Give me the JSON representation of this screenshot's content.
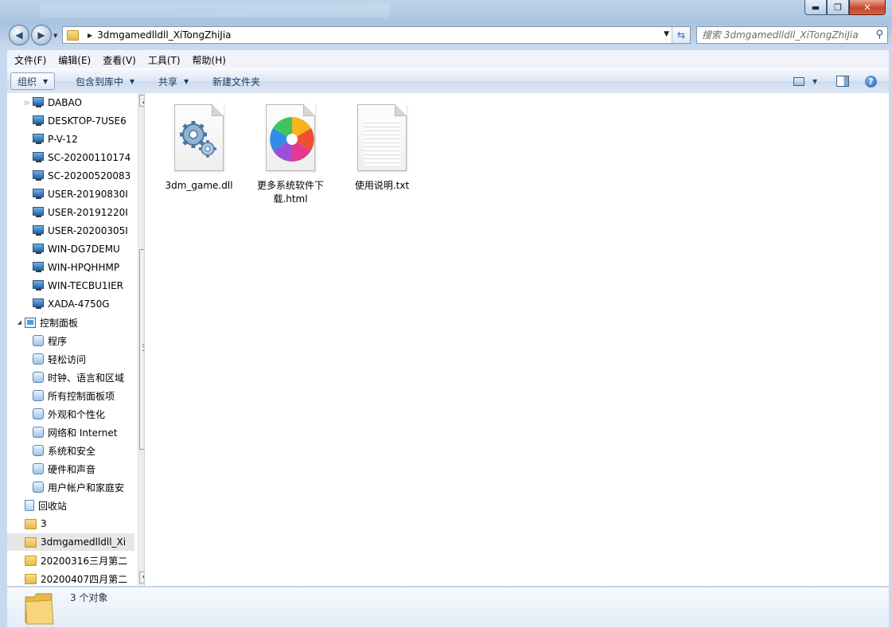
{
  "window": {
    "min_glyph": "▬",
    "max_glyph": "❐",
    "close_glyph": "✕"
  },
  "address": {
    "path": "3dmgamedlldll_XiTongZhiJia"
  },
  "search": {
    "placeholder": "搜索 3dmgamedlldll_XiTongZhiJia"
  },
  "menu": [
    "文件(F)",
    "编辑(E)",
    "查看(V)",
    "工具(T)",
    "帮助(H)"
  ],
  "toolbar": {
    "organize": "组织",
    "include_library": "包含到库中",
    "share": "共享",
    "new_folder": "新建文件夹"
  },
  "tree": [
    {
      "label": "DABAO",
      "icon": "computer-icon",
      "expander": "▷"
    },
    {
      "label": "DESKTOP-7USE6",
      "icon": "computer-icon",
      "expander": ""
    },
    {
      "label": "P-V-12",
      "icon": "computer-icon",
      "expander": ""
    },
    {
      "label": "SC-20200110174",
      "icon": "computer-icon",
      "expander": ""
    },
    {
      "label": "SC-20200520083",
      "icon": "computer-icon",
      "expander": ""
    },
    {
      "label": "USER-20190830I",
      "icon": "computer-icon",
      "expander": ""
    },
    {
      "label": "USER-20191220I",
      "icon": "computer-icon",
      "expander": ""
    },
    {
      "label": "USER-20200305I",
      "icon": "computer-icon",
      "expander": ""
    },
    {
      "label": "WIN-DG7DEMU",
      "icon": "computer-icon",
      "expander": ""
    },
    {
      "label": "WIN-HPQHHMP",
      "icon": "computer-icon",
      "expander": ""
    },
    {
      "label": "WIN-TECBU1IER",
      "icon": "computer-icon",
      "expander": ""
    },
    {
      "label": "XADA-4750G",
      "icon": "computer-icon",
      "expander": ""
    },
    {
      "label": "控制面板",
      "icon": "control-panel-icon",
      "expander": "◢"
    },
    {
      "label": "程序",
      "icon": "programs-icon",
      "expander": ""
    },
    {
      "label": "轻松访问",
      "icon": "ease-of-access-icon",
      "expander": ""
    },
    {
      "label": "时钟、语言和区域",
      "icon": "clock-language-icon",
      "expander": ""
    },
    {
      "label": "所有控制面板项",
      "icon": "control-panel-items-icon",
      "expander": ""
    },
    {
      "label": "外观和个性化",
      "icon": "appearance-icon",
      "expander": ""
    },
    {
      "label": "网络和 Internet",
      "icon": "network-icon",
      "expander": ""
    },
    {
      "label": "系统和安全",
      "icon": "system-security-icon",
      "expander": ""
    },
    {
      "label": "硬件和声音",
      "icon": "hardware-sound-icon",
      "expander": ""
    },
    {
      "label": "用户帐户和家庭安",
      "icon": "user-accounts-icon",
      "expander": ""
    },
    {
      "label": "回收站",
      "icon": "recycle-bin-icon",
      "expander": ""
    },
    {
      "label": "3",
      "icon": "folder-icon",
      "expander": ""
    },
    {
      "label": "3dmgamedlldll_Xi",
      "icon": "folder-icon",
      "expander": "",
      "selected": true
    },
    {
      "label": "20200316三月第二",
      "icon": "folder-icon",
      "expander": ""
    },
    {
      "label": "20200407四月第二",
      "icon": "folder-icon",
      "expander": ""
    }
  ],
  "files": [
    {
      "name": "3dm_game.dll",
      "icon": "dll-gear-icon"
    },
    {
      "name": "更多系统软件下载.html",
      "icon": "browser-html-icon"
    },
    {
      "name": "使用说明.txt",
      "icon": "text-file-icon"
    }
  ],
  "status": {
    "count": "3 个对象"
  }
}
